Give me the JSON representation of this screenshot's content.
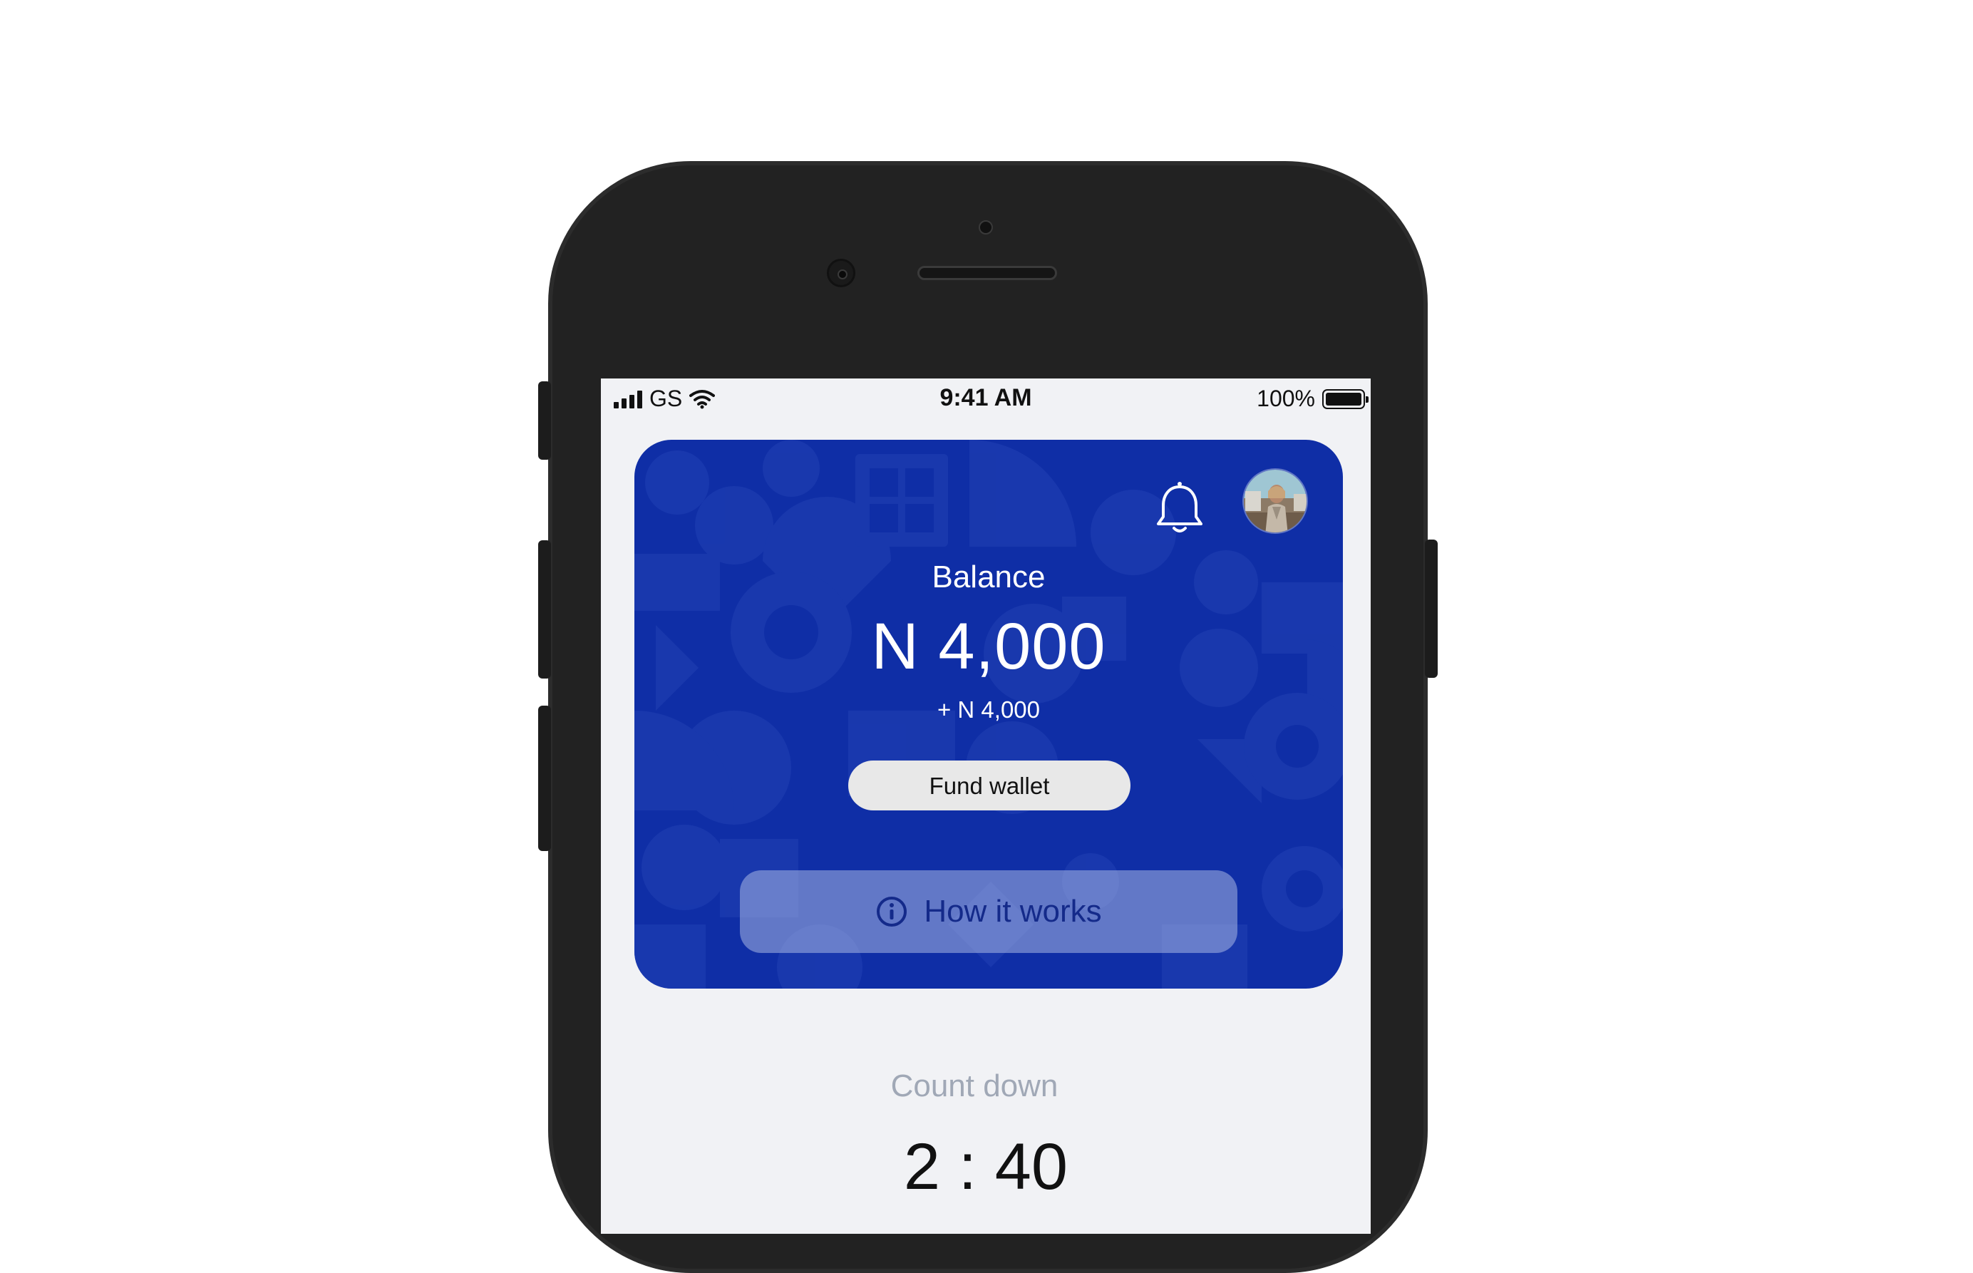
{
  "status_bar": {
    "carrier": "GS",
    "time": "9:41 AM",
    "battery": "100%",
    "icons": [
      "signal-icon",
      "wifi-icon",
      "battery-icon"
    ]
  },
  "wallet_card": {
    "balance_label": "Balance",
    "balance_amount": "N 4,000",
    "balance_change": "+ N 4,000",
    "fund_button_label": "Fund wallet",
    "how_it_works_label": "How it works",
    "icons": [
      "bell-icon",
      "avatar",
      "info-icon"
    ],
    "colors": {
      "card": "#0f2ea6",
      "accent_text": "#142a8a"
    }
  },
  "countdown": {
    "label": "Count down",
    "value": "2 : 40"
  }
}
